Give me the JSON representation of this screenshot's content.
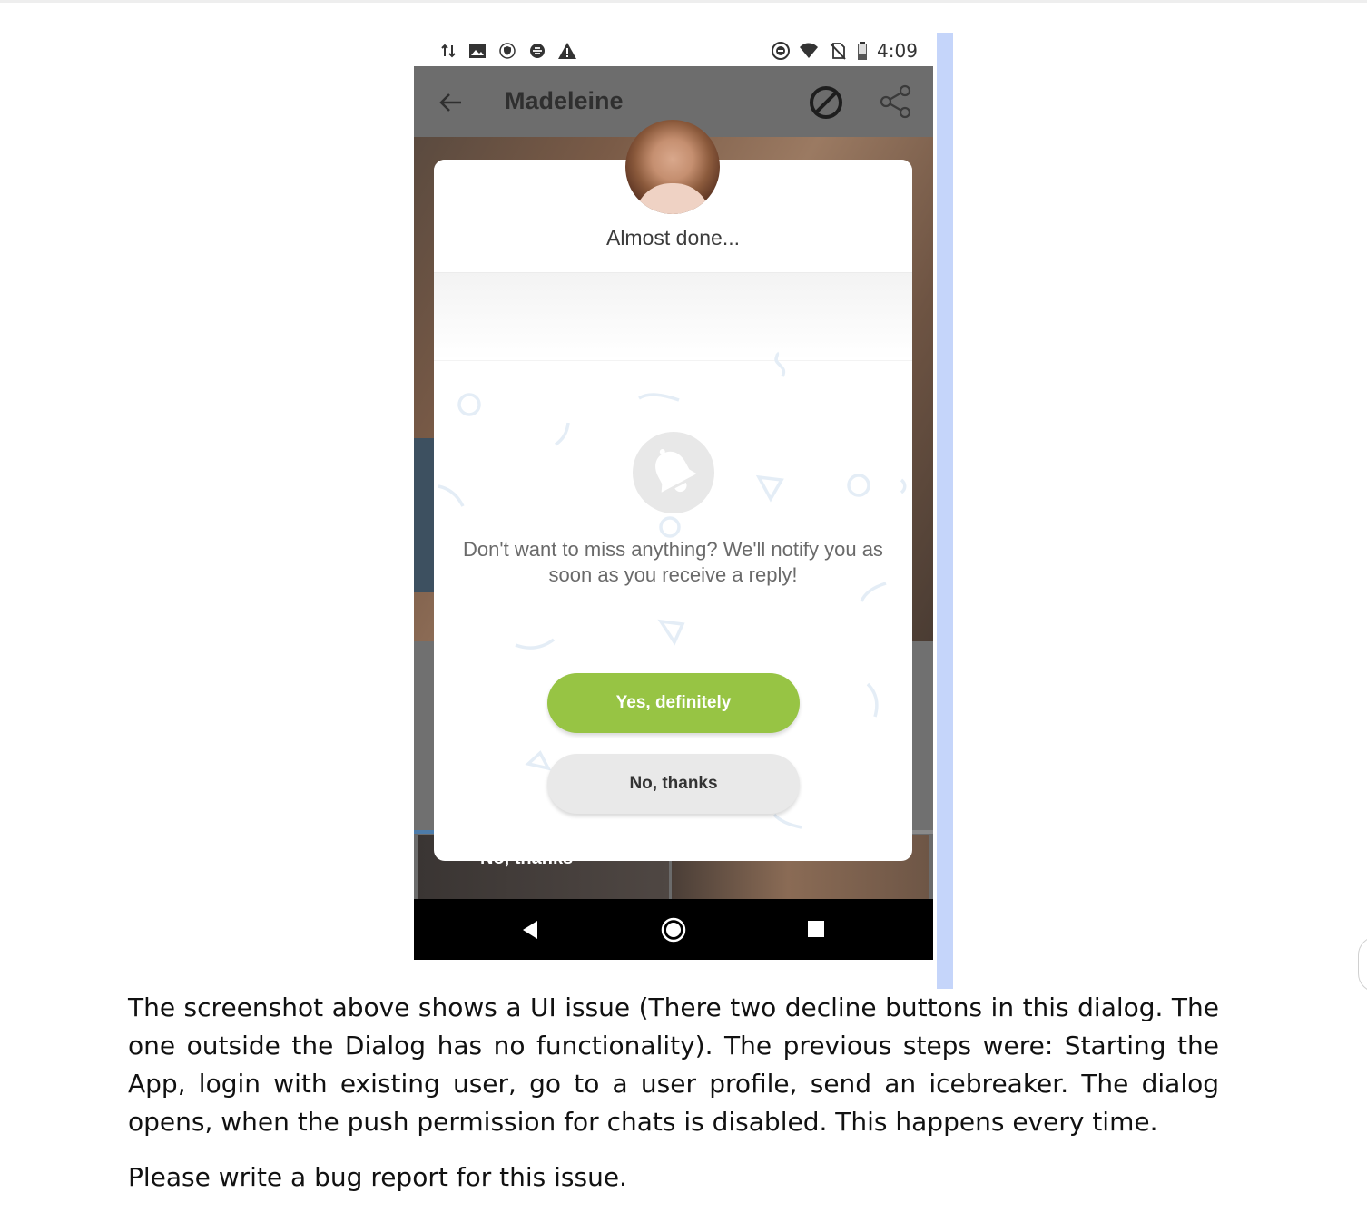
{
  "statusbar": {
    "time": "4:09",
    "left_icons": [
      "data-transfer-icon",
      "image-icon",
      "shield-icon",
      "sync-icon",
      "warning-icon"
    ],
    "right_icons": [
      "do-not-disturb-icon",
      "wifi-icon",
      "no-sim-icon",
      "battery-icon"
    ]
  },
  "appbar": {
    "title": "Madeleine",
    "icons": [
      "back-arrow-icon",
      "block-icon",
      "share-icon"
    ]
  },
  "dialog": {
    "title": "Almost done...",
    "message": "Don't want to miss anything? We'll notify you as soon as you receive a reply!",
    "primary_button": "Yes, definitely",
    "secondary_button": "No, thanks",
    "icon": "bell-icon"
  },
  "background": {
    "thumbnail_label": "No, thanks"
  },
  "navbar": {
    "icons": [
      "nav-back-icon",
      "nav-home-icon",
      "nav-recents-icon"
    ]
  },
  "colors": {
    "primary_button": "#97c444",
    "secondary_button": "#e9e9e9",
    "selection_bar": "#c5d5fa"
  },
  "caption": {
    "paragraph": "The screenshot above shows a UI issue (There two decline buttons in this dialog. The one outside the Dialog has no functionality). The previous steps were: Starting the App, login with existing user, go to a user profile, send an icebreaker. The dialog opens, when the push permission for chats is disabled. This happens every time.",
    "request": "Please write a bug report for this issue."
  }
}
